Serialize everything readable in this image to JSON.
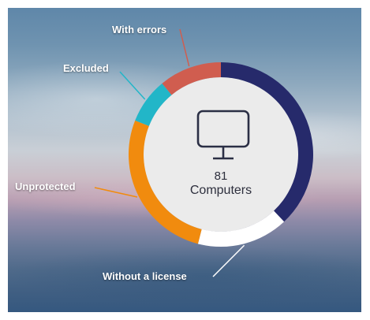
{
  "widget": {
    "total_count": "81",
    "total_label": "Computers",
    "center_icon": "computer-monitor-icon"
  },
  "chart_data": {
    "type": "pie",
    "values": [
      38,
      16,
      27,
      8,
      11
    ],
    "colors": [
      "#262a6b",
      "#ffffff",
      "#f18b0e",
      "#22b6c8",
      "#d05d4f"
    ],
    "labels": [
      "",
      "Without a license",
      "Unprotected",
      "Excluded",
      "With errors"
    ]
  }
}
